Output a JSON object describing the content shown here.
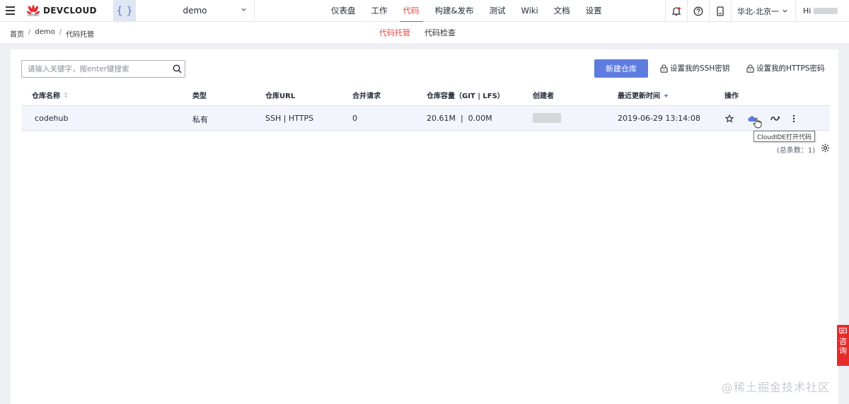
{
  "brand": {
    "name": "DEVCLOUD",
    "sub": "HUAWEI"
  },
  "project": {
    "icon": "{ }",
    "name": "demo"
  },
  "nav": [
    {
      "label": "仪表盘"
    },
    {
      "label": "工作"
    },
    {
      "label": "代码"
    },
    {
      "label": "构建&发布"
    },
    {
      "label": "测试"
    },
    {
      "label": "Wiki"
    },
    {
      "label": "文档"
    },
    {
      "label": "设置"
    }
  ],
  "nav_active": "代码",
  "header_right": {
    "region": "华北-北京一",
    "greeting": "Hi"
  },
  "breadcrumb": {
    "home": "首页",
    "sep1": "/",
    "project": "demo",
    "sep2": "/",
    "current": "代码托管"
  },
  "subnav": [
    {
      "label": "代码托管"
    },
    {
      "label": "代码检查"
    }
  ],
  "toolbar": {
    "search_placeholder": "请输入关键字，按enter键搜索",
    "new_repo": "新建仓库",
    "ssh_key": "设置我的SSH密钥",
    "https_pwd": "设置我的HTTPS密码"
  },
  "table": {
    "columns": [
      "仓库名称",
      "类型",
      "仓库URL",
      "合并请求",
      "仓库容量（GIT | LFS）",
      "创建者",
      "最近更新时间",
      "操作"
    ],
    "rows": [
      {
        "name": "codehub",
        "type": "私有",
        "url": "SSH | HTTPS",
        "merge": "0",
        "capacity": "20.61M  |  0.00M",
        "updated": "2019-06-29 13:14:08"
      }
    ]
  },
  "tooltip": "CloudIDE打开代码",
  "total": "(总条数：1)",
  "consult": [
    "咨",
    "询"
  ],
  "watermark": "@稀土掘金技术社区",
  "colors": {
    "accent": "#5e7ce0",
    "active": "#e0463f"
  }
}
